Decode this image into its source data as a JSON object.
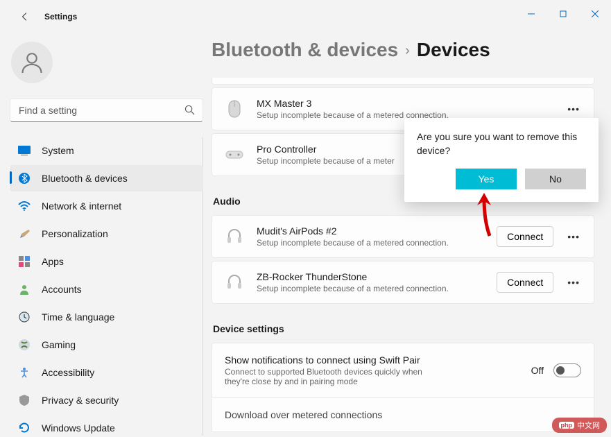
{
  "window": {
    "title": "Settings"
  },
  "search": {
    "placeholder": "Find a setting"
  },
  "nav": {
    "items": [
      {
        "label": "System"
      },
      {
        "label": "Bluetooth & devices"
      },
      {
        "label": "Network & internet"
      },
      {
        "label": "Personalization"
      },
      {
        "label": "Apps"
      },
      {
        "label": "Accounts"
      },
      {
        "label": "Time & language"
      },
      {
        "label": "Gaming"
      },
      {
        "label": "Accessibility"
      },
      {
        "label": "Privacy & security"
      },
      {
        "label": "Windows Update"
      }
    ]
  },
  "breadcrumb": {
    "parent": "Bluetooth & devices",
    "current": "Devices"
  },
  "devices": {
    "mouse": {
      "name": "MX Master 3",
      "status": "Setup incomplete because of a metered connection."
    },
    "controller": {
      "name": "Pro Controller",
      "status": "Setup incomplete because of a meter"
    },
    "audio1": {
      "name": "Mudit's AirPods #2",
      "status": "Setup incomplete because of a metered connection.",
      "action": "Connect"
    },
    "audio2": {
      "name": "ZB-Rocker ThunderStone",
      "status": "Setup incomplete because of a metered connection.",
      "action": "Connect"
    }
  },
  "sections": {
    "audio": "Audio",
    "settings": "Device settings"
  },
  "swift": {
    "title": "Show notifications to connect using Swift Pair",
    "desc": "Connect to supported Bluetooth devices quickly when they're close by and in pairing mode",
    "state": "Off"
  },
  "cutoff": "Download over metered connections",
  "dialog": {
    "text": "Are you sure you want to remove this device?",
    "yes": "Yes",
    "no": "No"
  },
  "watermark": "php 中文网"
}
